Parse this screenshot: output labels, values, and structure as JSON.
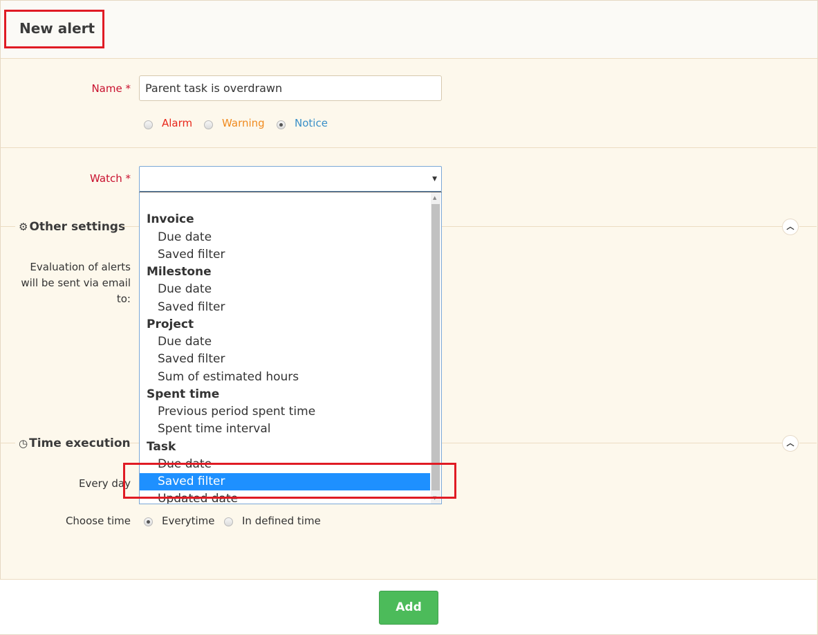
{
  "header": {
    "title": "New alert"
  },
  "form": {
    "name_label": "Name",
    "required_mark": "*",
    "name_value": "Parent task is overdrawn",
    "severity": [
      {
        "label": "Alarm",
        "color": "#e8271a",
        "checked": false
      },
      {
        "label": "Warning",
        "color": "#f08a1e",
        "checked": false
      },
      {
        "label": "Notice",
        "color": "#3a8fc8",
        "checked": true
      }
    ],
    "watch_label": "Watch",
    "watch_value": ""
  },
  "other_settings": {
    "title": "Other settings",
    "icon": "gear-icon",
    "email_label": "Evaluation of alerts will be sent via email to:"
  },
  "time_execution": {
    "title": "Time execution",
    "icon": "clock-icon",
    "every_day_label": "Every day",
    "choose_time_label": "Choose time",
    "choose_time_options": [
      {
        "label": "Everytime",
        "checked": true
      },
      {
        "label": "In defined time",
        "checked": false
      }
    ]
  },
  "dropdown": {
    "options": [
      {
        "type": "blank",
        "label": ""
      },
      {
        "type": "group",
        "label": "Invoice"
      },
      {
        "type": "item",
        "label": "Due date"
      },
      {
        "type": "item",
        "label": "Saved filter"
      },
      {
        "type": "group",
        "label": "Milestone"
      },
      {
        "type": "item",
        "label": "Due date"
      },
      {
        "type": "item",
        "label": "Saved filter"
      },
      {
        "type": "group",
        "label": "Project"
      },
      {
        "type": "item",
        "label": "Due date"
      },
      {
        "type": "item",
        "label": "Saved filter"
      },
      {
        "type": "item",
        "label": "Sum of estimated hours"
      },
      {
        "type": "group",
        "label": "Spent time"
      },
      {
        "type": "item",
        "label": "Previous period spent time"
      },
      {
        "type": "item",
        "label": "Spent time interval"
      },
      {
        "type": "group",
        "label": "Task"
      },
      {
        "type": "item",
        "label": "Due date"
      },
      {
        "type": "item",
        "label": "Saved filter",
        "selected": true
      },
      {
        "type": "item",
        "label": "Updated date"
      }
    ],
    "highlight_color": "#1e90ff"
  },
  "footer": {
    "add_label": "Add",
    "add_color": "#4cbb5a"
  },
  "annotation_color": "#e01b24"
}
